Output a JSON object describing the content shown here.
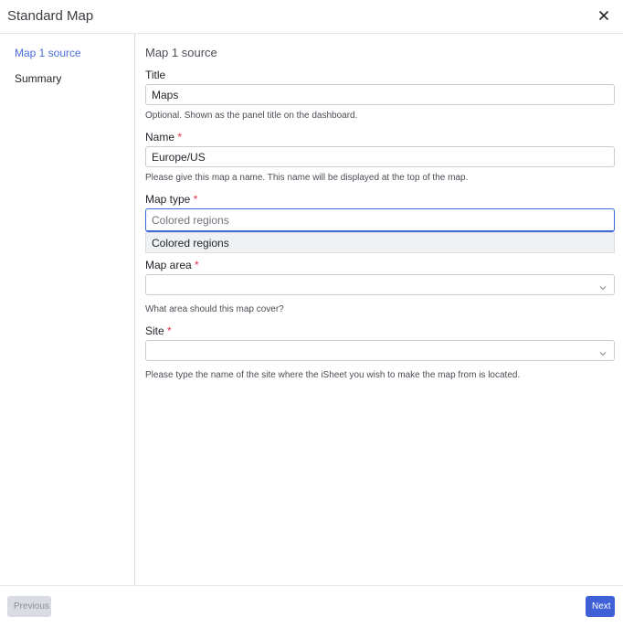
{
  "dialog": {
    "title": "Standard Map",
    "close_icon": "close-icon"
  },
  "sidebar": {
    "items": [
      {
        "label": "Map 1 source",
        "active": true
      },
      {
        "label": "Summary",
        "active": false
      }
    ]
  },
  "form": {
    "section_title": "Map 1 source",
    "title_field": {
      "label": "Title",
      "value": "Maps",
      "help": "Optional. Shown as the panel title on the dashboard."
    },
    "name_field": {
      "label": "Name",
      "required_mark": "*",
      "value": "Europe/US",
      "help": "Please give this map a name. This name will be displayed at the top of the map."
    },
    "map_type_field": {
      "label": "Map type",
      "required_mark": "*",
      "placeholder": "Colored regions",
      "options": [
        "Colored regions"
      ]
    },
    "map_area_field": {
      "label": "Map area",
      "required_mark": "*",
      "value": "",
      "help": "What area should this map cover?"
    },
    "site_field": {
      "label": "Site",
      "required_mark": "*",
      "value": "",
      "help": "Please type the name of the site where the iSheet you wish to make the map from is located."
    }
  },
  "footer": {
    "previous_label": "Previous",
    "next_label": "Next"
  },
  "colors": {
    "accent": "#4060d8",
    "active_nav": "#4b6fd8",
    "required": "#e0344a"
  }
}
